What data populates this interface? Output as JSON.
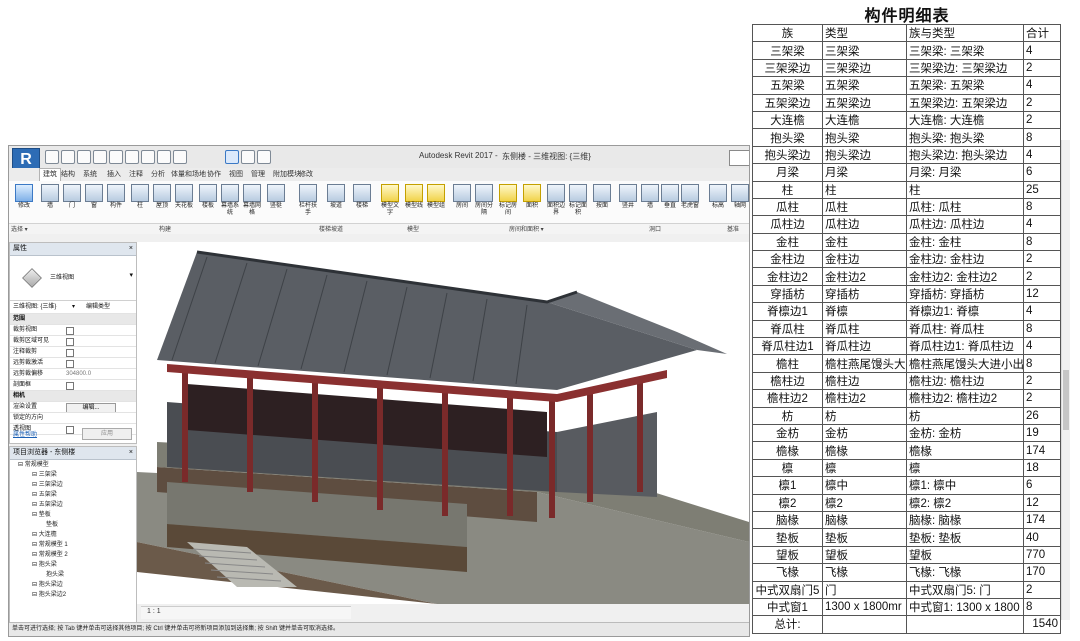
{
  "schedule": {
    "title": "构件明细表",
    "columns": [
      "族",
      "类型",
      "族与类型",
      "合计"
    ],
    "rows": [
      [
        "三架梁",
        "三架梁",
        "三架梁: 三架梁",
        "4"
      ],
      [
        "三架梁边",
        "三架梁边",
        "三架梁边: 三架梁边",
        "2"
      ],
      [
        "五架梁",
        "五架梁",
        "五架梁: 五架梁",
        "4"
      ],
      [
        "五架梁边",
        "五架梁边",
        "五架梁边: 五架梁边",
        "2"
      ],
      [
        "大连檐",
        "大连檐",
        "大连檐: 大连檐",
        "2"
      ],
      [
        "抱头梁",
        "抱头梁",
        "抱头梁: 抱头梁",
        "8"
      ],
      [
        "抱头梁边",
        "抱头梁边",
        "抱头梁边: 抱头梁边",
        "4"
      ],
      [
        "月梁",
        "月梁",
        "月梁: 月梁",
        "6"
      ],
      [
        "柱",
        "柱",
        "柱",
        "25"
      ],
      [
        "瓜柱",
        "瓜柱",
        "瓜柱: 瓜柱",
        "8"
      ],
      [
        "瓜柱边",
        "瓜柱边",
        "瓜柱边: 瓜柱边",
        "4"
      ],
      [
        "金柱",
        "金柱",
        "金柱: 金柱",
        "8"
      ],
      [
        "金柱边",
        "金柱边",
        "金柱边: 金柱边",
        "2"
      ],
      [
        "金柱边2",
        "金柱边2",
        "金柱边2: 金柱边2",
        "2"
      ],
      [
        "穿插枋",
        "穿插枋",
        "穿插枋: 穿插枋",
        "12"
      ],
      [
        "脊檩边1",
        "脊檩",
        "脊檩边1: 脊檩",
        "4"
      ],
      [
        "脊瓜柱",
        "脊瓜柱",
        "脊瓜柱: 脊瓜柱",
        "8"
      ],
      [
        "脊瓜柱边1",
        "脊瓜柱边",
        "脊瓜柱边1: 脊瓜柱边",
        "4"
      ],
      [
        "檐柱",
        "檐柱燕尾馒头大",
        "檐柱燕尾馒头大进小出",
        "8"
      ],
      [
        "檐柱边",
        "檐柱边",
        "檐柱边: 檐柱边",
        "2"
      ],
      [
        "檐柱边2",
        "檐柱边2",
        "檐柱边2: 檐柱边2",
        "2"
      ],
      [
        "枋",
        "枋",
        "枋",
        "26"
      ],
      [
        "金枋",
        "金枋",
        "金枋: 金枋",
        "19"
      ],
      [
        "檐椽",
        "檐椽",
        "檐椽",
        "174"
      ],
      [
        "檩",
        "檩",
        "檩",
        "18"
      ],
      [
        "檩1",
        "檩中",
        "檩1: 檩中",
        "6"
      ],
      [
        "檩2",
        "檩2",
        "檩2: 檩2",
        "12"
      ],
      [
        "脑椽",
        "脑椽",
        "脑椽: 脑椽",
        "174"
      ],
      [
        "垫板",
        "垫板",
        "垫板: 垫板",
        "40"
      ],
      [
        "望板",
        "望板",
        "望板",
        "770"
      ],
      [
        "飞椽",
        "飞椽",
        "飞椽: 飞椽",
        "170"
      ],
      [
        "中式双扇门5",
        "门",
        "中式双扇门5: 门",
        "2"
      ],
      [
        "中式窗1",
        "1300 x 1800mr",
        "中式窗1: 1300 x 1800",
        "8"
      ]
    ],
    "total_label": "总计:",
    "total_value": "1540"
  },
  "revit": {
    "logo": "R",
    "app_title": "Autodesk Revit 2017 -",
    "doc_title": "东侧楼 - 三维视图: {三维}",
    "tabs": [
      "建筑",
      "结构",
      "系统",
      "插入",
      "注释",
      "分析",
      "体量和场地",
      "协作",
      "视图",
      "管理",
      "附加模块",
      "修改"
    ],
    "ribbon_buttons": [
      "修改",
      "墙",
      "门",
      "窗",
      "构件",
      "柱",
      "屋顶",
      "天花板",
      "楼板",
      "幕墙系统",
      "幕墙网格",
      "竖梃",
      "栏杆扶手",
      "坡道",
      "楼梯",
      "模型文字",
      "模型线",
      "模型组",
      "房间",
      "房间分隔",
      "标记房间",
      "面积",
      "面积边界",
      "标记面积",
      "按面",
      "竖井",
      "墙",
      "垂直",
      "老虎窗",
      "标高",
      "轴网"
    ],
    "ribbon_groups": [
      "选择 ▾",
      "构建",
      "楼梯坡道",
      "模型",
      "房间和面积 ▾",
      "洞口",
      "基准"
    ],
    "properties": {
      "title": "属性",
      "type_name": "三维视图",
      "view_selector": "三维视图: {三维}",
      "edit_type": "编辑类型",
      "rows": [
        {
          "label": "范围",
          "kind": "header"
        },
        {
          "label": "裁剪视图",
          "kind": "check"
        },
        {
          "label": "裁剪区域可见",
          "kind": "check"
        },
        {
          "label": "注释裁剪",
          "kind": "check"
        },
        {
          "label": "远剪裁激活",
          "kind": "check"
        },
        {
          "label": "远剪裁偏移",
          "kind": "value",
          "value": "304800.0"
        },
        {
          "label": "剖面框",
          "kind": "check"
        },
        {
          "label": "相机",
          "kind": "header"
        },
        {
          "label": "渲染设置",
          "kind": "button",
          "value": "编辑..."
        },
        {
          "label": "锁定的方向",
          "kind": "text"
        },
        {
          "label": "透视图",
          "kind": "check"
        }
      ],
      "help": "属性帮助",
      "apply": "应用"
    },
    "browser": {
      "title": "项目浏览器 - 东侧楼",
      "items": [
        "常规模型",
        "三架梁",
        "三架梁边",
        "五架梁",
        "五架梁边",
        "垫板",
        "垫板",
        "大连檐",
        "常规模型 1",
        "常规模型 2",
        "抱头梁",
        "抱头梁",
        "抱头梁边",
        "抱头梁边2"
      ]
    },
    "view_scale": "1 : 1",
    "status": "单击可进行选择; 按 Tab 键并单击可选择其他项目; 按 Ctrl 键并单击可将新项目添加到选择集; 按 Shift 键并单击可取消选择。"
  }
}
